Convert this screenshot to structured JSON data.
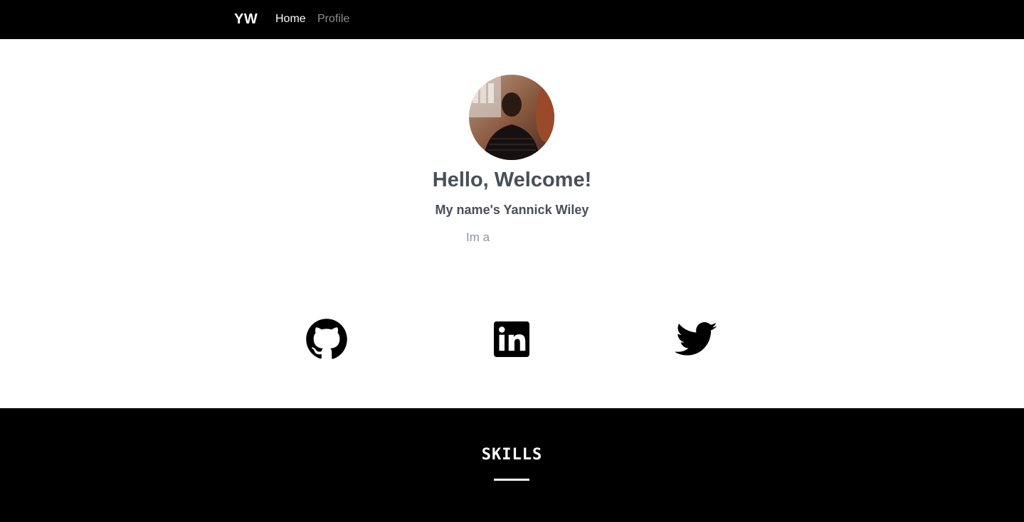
{
  "navbar": {
    "brand": "YW",
    "links": [
      {
        "label": "Home",
        "active": true
      },
      {
        "label": "Profile",
        "active": false
      }
    ]
  },
  "hero": {
    "avatar_alt": "Profile photo",
    "greeting": "Hello, Welcome!",
    "subtitle": "My name's Yannick Wiley",
    "typed_text": "Im a"
  },
  "social": [
    {
      "name": "GitHub",
      "icon": "github-icon"
    },
    {
      "name": "LinkedIn",
      "icon": "linkedin-icon"
    },
    {
      "name": "Twitter",
      "icon": "twitter-icon"
    }
  ],
  "skills": {
    "title": "SKILLS"
  },
  "colors": {
    "nav_bg": "#000000",
    "heading_text": "#474f57",
    "muted_text": "#8f9499",
    "inactive_link": "#8c8c8c"
  }
}
